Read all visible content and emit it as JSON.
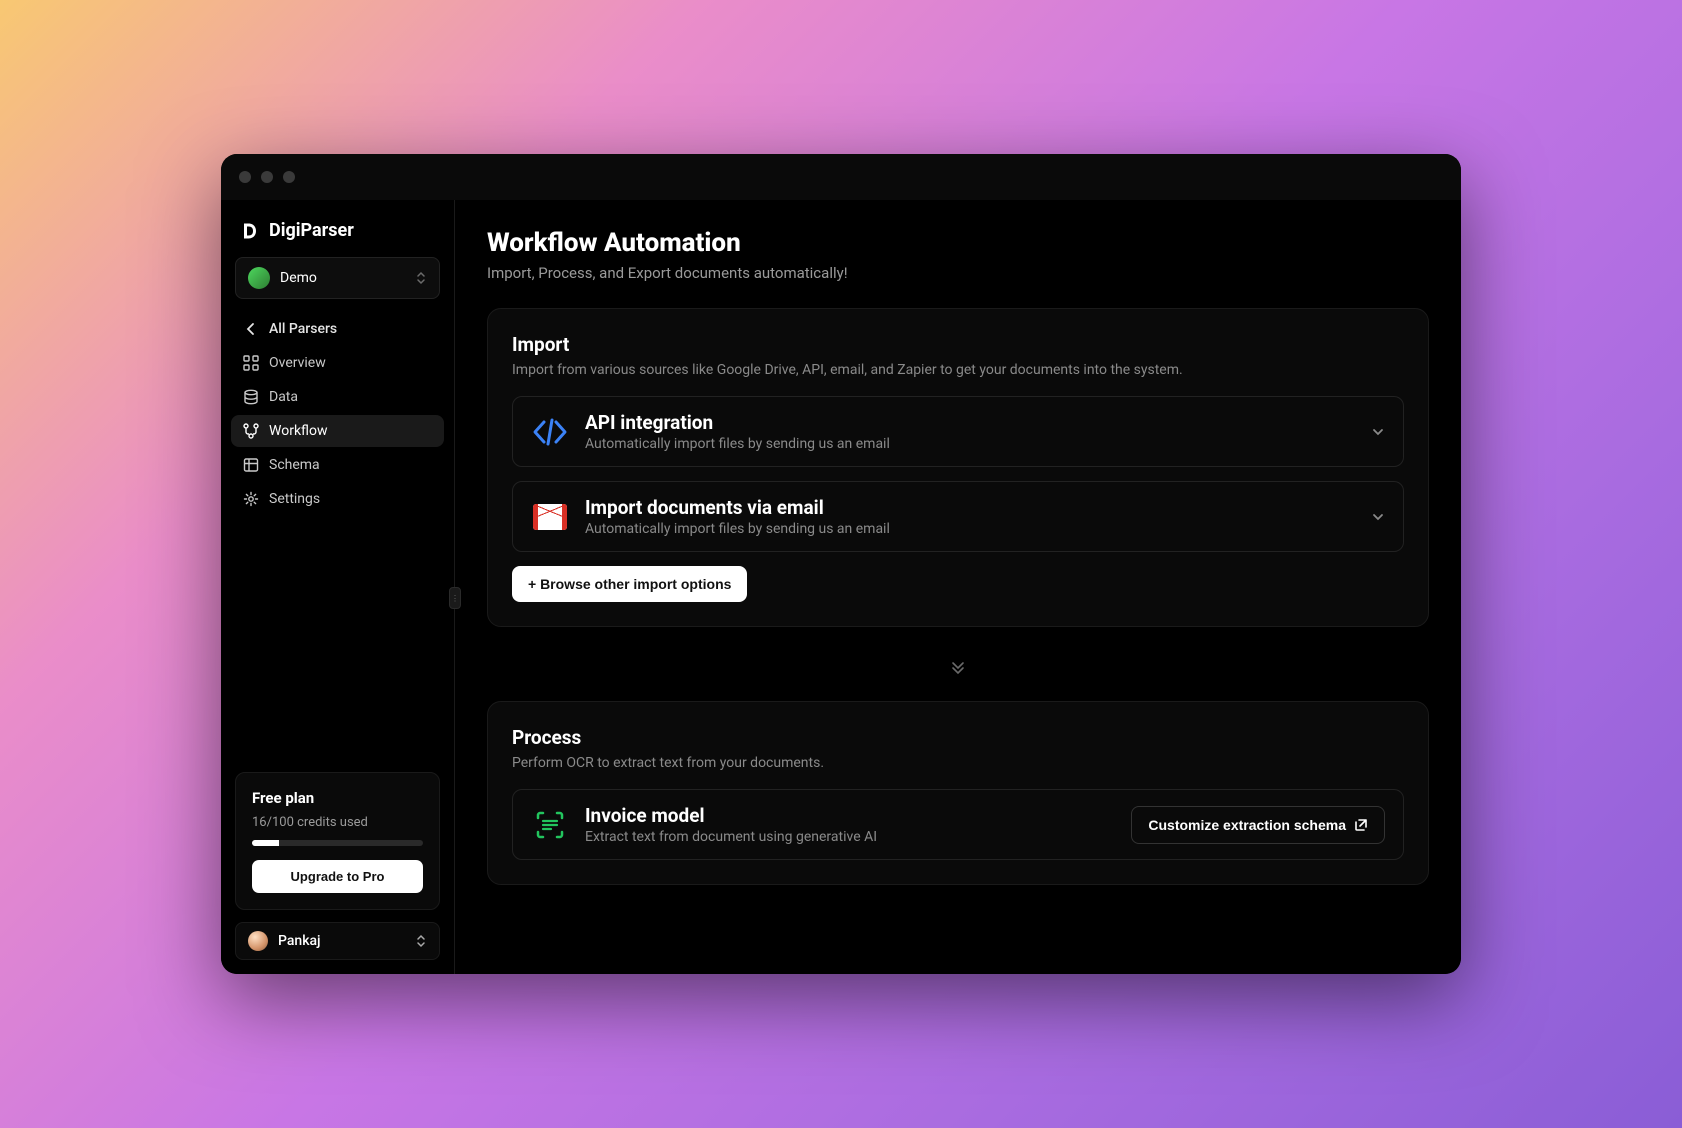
{
  "app": {
    "name": "DigiParser"
  },
  "workspace": {
    "label": "Demo"
  },
  "nav": {
    "back": "All Parsers",
    "items": [
      {
        "label": "Overview"
      },
      {
        "label": "Data"
      },
      {
        "label": "Workflow"
      },
      {
        "label": "Schema"
      },
      {
        "label": "Settings"
      }
    ]
  },
  "plan": {
    "title": "Free plan",
    "credits_text": "16/100 credits used",
    "progress_pct": 16,
    "upgrade_label": "Upgrade to Pro"
  },
  "user": {
    "name": "Pankaj"
  },
  "page": {
    "title": "Workflow Automation",
    "subtitle": "Import, Process, and Export documents automatically!"
  },
  "import": {
    "title": "Import",
    "desc": "Import from various sources like Google Drive, API, email, and Zapier to get your documents into the system.",
    "items": [
      {
        "title": "API integration",
        "desc": "Automatically import files by sending us an email"
      },
      {
        "title": "Import documents via email",
        "desc": "Automatically import files by sending us an email"
      }
    ],
    "browse_label": "+ Browse other import options"
  },
  "process": {
    "title": "Process",
    "desc": "Perform OCR to extract text from your documents.",
    "item": {
      "title": "Invoice model",
      "desc": "Extract text from document using generative AI"
    },
    "customize_label": "Customize extraction schema"
  }
}
